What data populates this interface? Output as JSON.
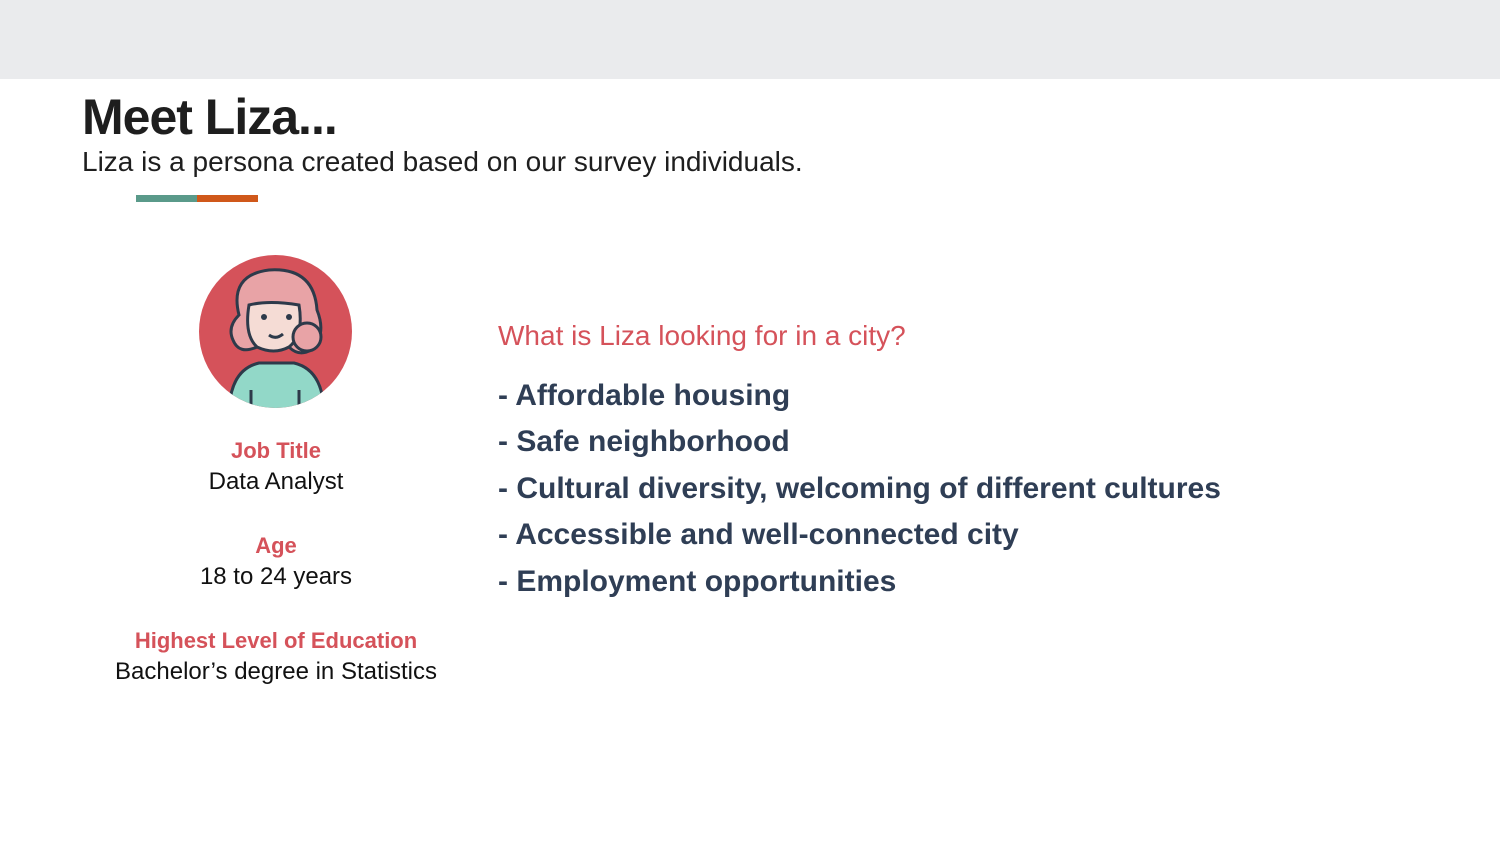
{
  "header": {
    "title": "Meet Liza...",
    "subtitle": "Liza is a persona created based on our survey individuals."
  },
  "colors": {
    "accent_teal": "#5a9a8a",
    "accent_orange": "#d0581a",
    "label_red": "#d5525a"
  },
  "persona": {
    "avatar_icon": "woman-avatar-icon",
    "job_title_label": "Job Title",
    "job_title": "Data Analyst",
    "age_label": "Age",
    "age": "18 to 24 years",
    "education_label": "Highest Level of Education",
    "education": "Bachelor’s degree in Statistics"
  },
  "needs": {
    "question": "What is Liza looking for in a city?",
    "items": [
      "- Affordable housing",
      "- Safe neighborhood",
      "- Cultural diversity, welcoming of different cultures",
      "- Accessible and well-connected city",
      "- Employment opportunities"
    ]
  }
}
